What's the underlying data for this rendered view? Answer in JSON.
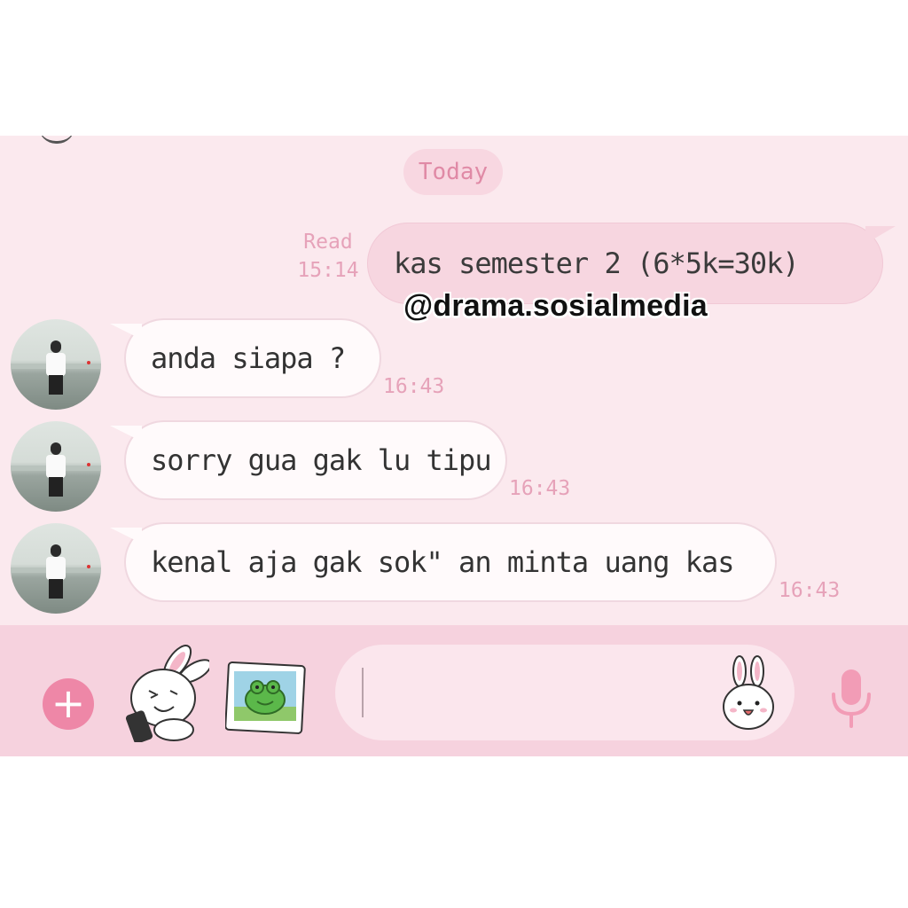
{
  "chat": {
    "date_chip": "Today",
    "outgoing": {
      "status": "Read",
      "time": "15:14",
      "text": "kas semester 2 (6*5k=30k)"
    },
    "watermark": "@drama.sosialmedia",
    "incoming": [
      {
        "text": "anda siapa ?",
        "time": "16:43"
      },
      {
        "text": "sorry gua gak lu tipu",
        "time": "16:43"
      },
      {
        "text": "kenal aja gak sok\" an minta uang kas",
        "time": "16:43"
      }
    ]
  },
  "input_bar": {
    "add_icon": "plus-icon",
    "sticker_icon": "bunny-phone-sticker-icon",
    "gallery_icon": "photo-frog-icon",
    "emoji_icon": "bunny-face-icon",
    "mic_icon": "microphone-icon",
    "input_value": ""
  },
  "colors": {
    "accent": "#ee87a7",
    "chat_bg": "#fbe9ee",
    "outgoing_bubble": "#f7d6e0",
    "meta_text": "#e6a2b9"
  }
}
